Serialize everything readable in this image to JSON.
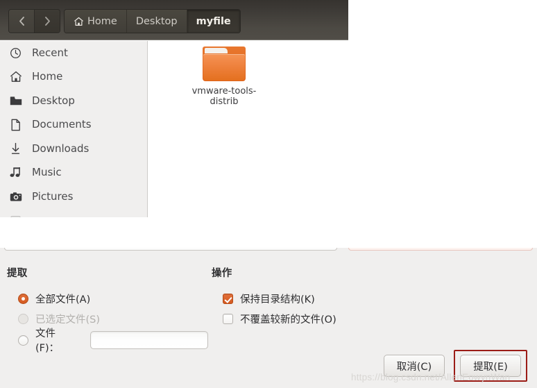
{
  "file_manager": {
    "nav": {
      "back_icon": "chevron-left-icon",
      "forward_icon": "chevron-right-icon"
    },
    "breadcrumbs": [
      {
        "label": "Home",
        "icon": "home-icon",
        "active": false
      },
      {
        "label": "Desktop",
        "icon": "",
        "active": false
      },
      {
        "label": "myfile",
        "icon": "",
        "active": true
      }
    ],
    "sidebar": [
      {
        "label": "Recent",
        "icon": "clock-icon"
      },
      {
        "label": "Home",
        "icon": "home-icon"
      },
      {
        "label": "Desktop",
        "icon": "folder-icon"
      },
      {
        "label": "Documents",
        "icon": "document-icon"
      },
      {
        "label": "Downloads",
        "icon": "download-arrow-icon"
      },
      {
        "label": "Music",
        "icon": "music-note-icon"
      },
      {
        "label": "Pictures",
        "icon": "camera-icon"
      }
    ],
    "files": [
      {
        "name": "vmware-tools-distrib",
        "icon": "folder-icon"
      }
    ]
  },
  "dialog": {
    "extract_section": {
      "title": "提取",
      "options": [
        {
          "label": "全部文件(A)",
          "selected": true,
          "disabled": false
        },
        {
          "label": "已选定文件(S)",
          "selected": false,
          "disabled": true
        },
        {
          "label": "文件(F)：",
          "selected": false,
          "disabled": false
        }
      ],
      "file_pattern_value": "",
      "file_pattern_placeholder": ""
    },
    "action_section": {
      "title": "操作",
      "options": [
        {
          "label": "保持目录结构(K)",
          "checked": true
        },
        {
          "label": "不覆盖较新的文件(O)",
          "checked": false
        }
      ]
    },
    "buttons": {
      "cancel": "取消(C)",
      "extract": "提取(E)"
    },
    "highlight_color": "#9b1c16"
  },
  "watermark": "https://blog.csdn.net/AllenEowynWan"
}
